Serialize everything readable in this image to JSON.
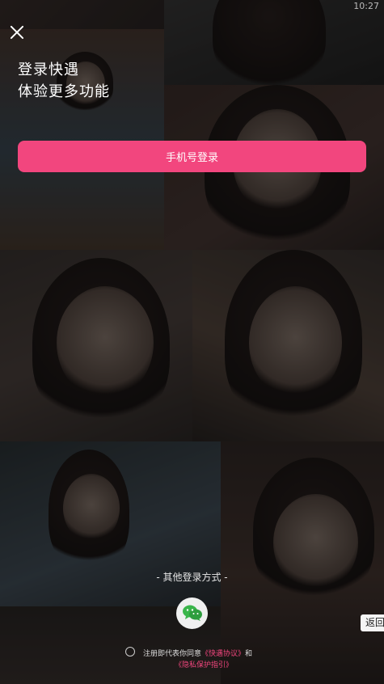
{
  "status_bar": {
    "time": "10:27"
  },
  "header": {
    "title_line1": "登录快遇",
    "title_line2": "体验更多功能"
  },
  "actions": {
    "phone_login_label": "手机号登录",
    "other_methods_label": "- 其他登录方式 -",
    "back_label": "返回"
  },
  "agreement": {
    "prefix": "注册即代表你同意",
    "user_agreement": "《快遇协议》",
    "connector": "和",
    "privacy_guide": "《隐私保护指引》"
  },
  "icons": {
    "close": "close-icon",
    "wechat": "wechat-icon"
  },
  "colors": {
    "accent": "#f2467e",
    "text": "#ffffff"
  }
}
